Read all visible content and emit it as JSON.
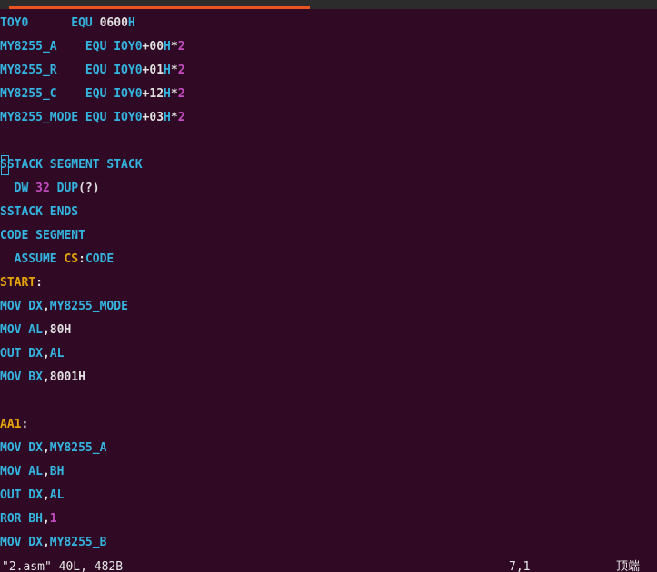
{
  "editor": {
    "lines": [
      [
        {
          "t": "TOY0      ",
          "c": "kw"
        },
        {
          "t": "EQU ",
          "c": "kw"
        },
        {
          "t": "0600",
          "c": "pl"
        },
        {
          "t": "H",
          "c": "kw"
        }
      ],
      [
        {
          "t": "MY8255_A    ",
          "c": "kw"
        },
        {
          "t": "EQU ",
          "c": "kw"
        },
        {
          "t": "IOY0",
          "c": "kw"
        },
        {
          "t": "+00",
          "c": "pl"
        },
        {
          "t": "H",
          "c": "kw"
        },
        {
          "t": "*",
          "c": "pl"
        },
        {
          "t": "2",
          "c": "num"
        }
      ],
      [
        {
          "t": "MY8255_R    ",
          "c": "kw"
        },
        {
          "t": "EQU ",
          "c": "kw"
        },
        {
          "t": "IOY0",
          "c": "kw"
        },
        {
          "t": "+01",
          "c": "pl"
        },
        {
          "t": "H",
          "c": "kw"
        },
        {
          "t": "*",
          "c": "pl"
        },
        {
          "t": "2",
          "c": "num"
        }
      ],
      [
        {
          "t": "MY8255_C    ",
          "c": "kw"
        },
        {
          "t": "EQU ",
          "c": "kw"
        },
        {
          "t": "IOY0",
          "c": "kw"
        },
        {
          "t": "+12",
          "c": "pl"
        },
        {
          "t": "H",
          "c": "kw"
        },
        {
          "t": "*",
          "c": "pl"
        },
        {
          "t": "2",
          "c": "num"
        }
      ],
      [
        {
          "t": "MY8255_MODE ",
          "c": "kw"
        },
        {
          "t": "EQU ",
          "c": "kw"
        },
        {
          "t": "IOY0",
          "c": "kw"
        },
        {
          "t": "+03",
          "c": "pl"
        },
        {
          "t": "H",
          "c": "kw"
        },
        {
          "t": "*",
          "c": "pl"
        },
        {
          "t": "2",
          "c": "num"
        }
      ],
      [],
      [
        {
          "t": "SSTACK SEGMENT STACK",
          "c": "kw"
        }
      ],
      [
        {
          "t": "  DW ",
          "c": "kw"
        },
        {
          "t": "32",
          "c": "num"
        },
        {
          "t": " DUP",
          "c": "kw"
        },
        {
          "t": "(?)",
          "c": "pl"
        }
      ],
      [
        {
          "t": "SSTACK ENDS",
          "c": "kw"
        }
      ],
      [
        {
          "t": "CODE SEGMENT",
          "c": "kw"
        }
      ],
      [
        {
          "t": "  ASSUME ",
          "c": "kw"
        },
        {
          "t": "CS",
          "c": "lbl"
        },
        {
          "t": ":",
          "c": "pl"
        },
        {
          "t": "CODE",
          "c": "kw"
        }
      ],
      [
        {
          "t": "START",
          "c": "lbl"
        },
        {
          "t": ":",
          "c": "pl"
        }
      ],
      [
        {
          "t": "MOV DX",
          "c": "kw"
        },
        {
          "t": ",",
          "c": "pl"
        },
        {
          "t": "MY8255_MODE",
          "c": "kw"
        }
      ],
      [
        {
          "t": "MOV AL",
          "c": "kw"
        },
        {
          "t": ",",
          "c": "pl"
        },
        {
          "t": "80H",
          "c": "pl"
        }
      ],
      [
        {
          "t": "OUT DX",
          "c": "kw"
        },
        {
          "t": ",",
          "c": "pl"
        },
        {
          "t": "AL",
          "c": "kw"
        }
      ],
      [
        {
          "t": "MOV BX",
          "c": "kw"
        },
        {
          "t": ",",
          "c": "pl"
        },
        {
          "t": "8001H",
          "c": "pl"
        }
      ],
      [],
      [
        {
          "t": "AA1",
          "c": "lbl"
        },
        {
          "t": ":",
          "c": "pl"
        }
      ],
      [
        {
          "t": "MOV DX",
          "c": "kw"
        },
        {
          "t": ",",
          "c": "pl"
        },
        {
          "t": "MY8255_A",
          "c": "kw"
        }
      ],
      [
        {
          "t": "MOV AL",
          "c": "kw"
        },
        {
          "t": ",",
          "c": "pl"
        },
        {
          "t": "BH",
          "c": "kw"
        }
      ],
      [
        {
          "t": "OUT DX",
          "c": "kw"
        },
        {
          "t": ",",
          "c": "pl"
        },
        {
          "t": "AL",
          "c": "kw"
        }
      ],
      [
        {
          "t": "ROR BH",
          "c": "kw"
        },
        {
          "t": ",",
          "c": "pl"
        },
        {
          "t": "1",
          "c": "num"
        }
      ],
      [
        {
          "t": "MOV DX",
          "c": "kw"
        },
        {
          "t": ",",
          "c": "pl"
        },
        {
          "t": "MY8255_B",
          "c": "kw"
        }
      ]
    ]
  },
  "status": {
    "file_info": "\"2.asm\" 40L, 482B",
    "cursor_pos": "7,1",
    "scroll": "顶端"
  },
  "colors": {
    "background": "#300a24",
    "keyword": "#33b5e0",
    "number": "#c44bbf",
    "label": "#e5a50a",
    "plain": "#e0e0e0",
    "tab_accent": "#e95420"
  }
}
